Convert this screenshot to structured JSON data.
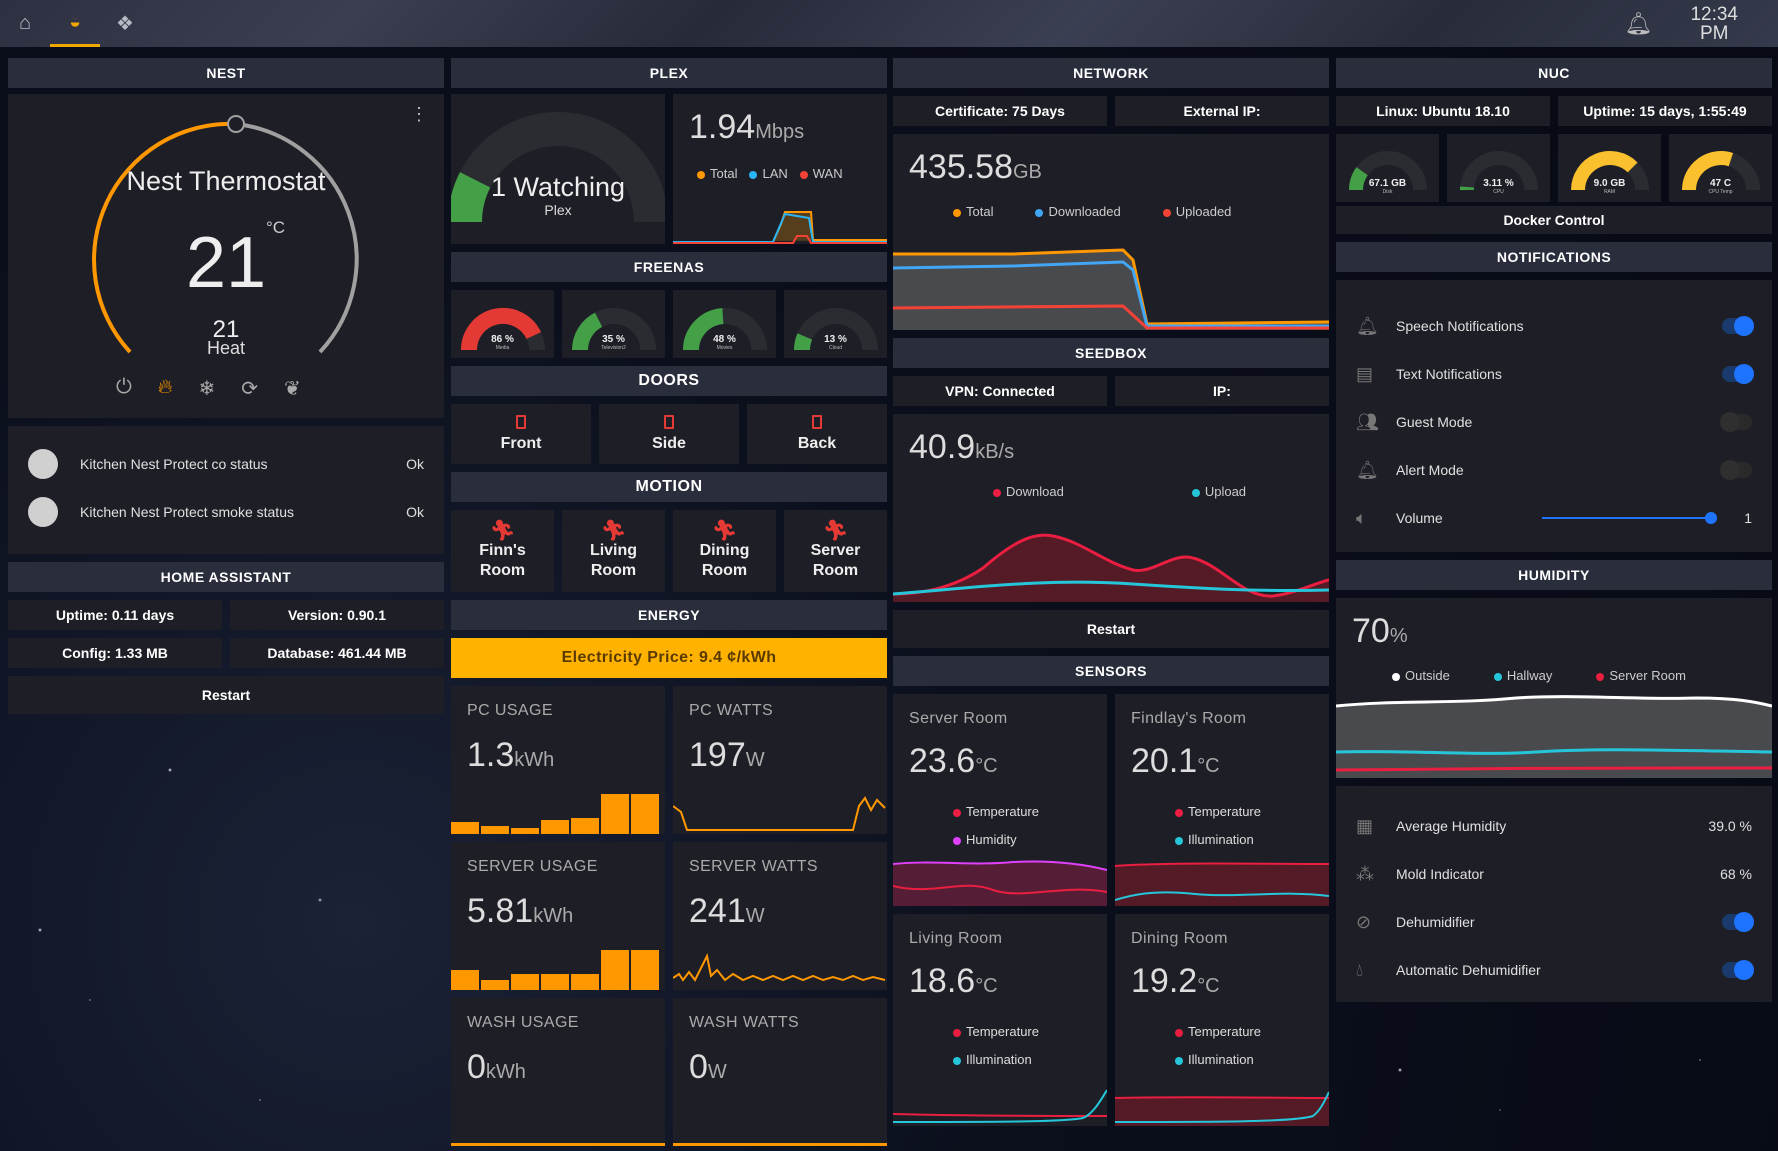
{
  "topbar": {
    "tabs": [
      "home-icon",
      "dashboard-icon",
      "plex-icon"
    ],
    "active_tab": 1,
    "clock_time": "12:34",
    "clock_ampm": "PM"
  },
  "nest": {
    "header": "NEST",
    "name": "Nest Thermostat",
    "target": "21",
    "unit": "°C",
    "current": "21",
    "mode": "Heat",
    "protect": [
      {
        "label": "Kitchen Nest Protect co status",
        "value": "Ok"
      },
      {
        "label": "Kitchen Nest Protect smoke status",
        "value": "Ok"
      }
    ]
  },
  "ha": {
    "header": "HOME ASSISTANT",
    "uptime": "Uptime: 0.11 days",
    "version": "Version: 0.90.1",
    "config": "Config: 1.33 MB",
    "database": "Database: 461.44 MB",
    "restart": "Restart"
  },
  "plex": {
    "header": "PLEX",
    "watching": "1 Watching",
    "watching_sub": "Plex",
    "watching_fraction": 0.15,
    "speed": "1.94",
    "speed_unit": "Mbps",
    "legend": [
      "Total",
      "LAN",
      "WAN"
    ]
  },
  "freenas": {
    "header": "FREENAS",
    "gauges": [
      {
        "value": "86 %",
        "label": "Media",
        "pct": 86,
        "color": "#e53935"
      },
      {
        "value": "35 %",
        "label": "Television2",
        "pct": 35,
        "color": "#43a047"
      },
      {
        "value": "48 %",
        "label": "Movies",
        "pct": 48,
        "color": "#43a047"
      },
      {
        "value": "13 %",
        "label": "Cloud",
        "pct": 13,
        "color": "#43a047"
      }
    ]
  },
  "doors": {
    "header": "DOORS",
    "items": [
      "Front",
      "Side",
      "Back"
    ]
  },
  "motion": {
    "header": "MOTION",
    "items": [
      [
        "Finn's",
        "Room"
      ],
      [
        "Living",
        "Room"
      ],
      [
        "Dining",
        "Room"
      ],
      [
        "Server",
        "Room"
      ]
    ]
  },
  "energy": {
    "header": "ENERGY",
    "price": "Electricity Price: 9.4 ¢/kWh",
    "tiles": [
      {
        "title": "PC USAGE",
        "value": "1.3",
        "unit": "kWh"
      },
      {
        "title": "PC WATTS",
        "value": "197",
        "unit": "W"
      },
      {
        "title": "SERVER USAGE",
        "value": "5.81",
        "unit": "kWh"
      },
      {
        "title": "SERVER WATTS",
        "value": "241",
        "unit": "W"
      },
      {
        "title": "WASH USAGE",
        "value": "0",
        "unit": "kWh"
      },
      {
        "title": "WASH WATTS",
        "value": "0",
        "unit": "W"
      }
    ]
  },
  "network": {
    "header": "NETWORK",
    "certificate": "Certificate: 75 Days",
    "external_ip": "External IP:",
    "total": "435.58",
    "unit": "GB",
    "legend": [
      "Total",
      "Downloaded",
      "Uploaded"
    ]
  },
  "seedbox": {
    "header": "SEEDBOX",
    "vpn": "VPN: Connected",
    "ip": "IP:",
    "speed": "40.9",
    "unit": "kB/s",
    "legend": [
      "Download",
      "Upload"
    ],
    "restart": "Restart"
  },
  "sensors": {
    "header": "SENSORS",
    "rooms": [
      {
        "name": "Server Room",
        "temp": "23.6",
        "unit": "°C",
        "l1": "Temperature",
        "l2": "Humidity",
        "c2": "#e040fb"
      },
      {
        "name": "Findlay's Room",
        "temp": "20.1",
        "unit": "°C",
        "l1": "Temperature",
        "l2": "Illumination",
        "c2": "#26c6da"
      },
      {
        "name": "Living Room",
        "temp": "18.6",
        "unit": "°C",
        "l1": "Temperature",
        "l2": "Illumination",
        "c2": "#26c6da"
      },
      {
        "name": "Dining Room",
        "temp": "19.2",
        "unit": "°C",
        "l1": "Temperature",
        "l2": "Illumination",
        "c2": "#26c6da"
      }
    ]
  },
  "nuc": {
    "header": "NUC",
    "os": "Linux: Ubuntu 18.10",
    "uptime": "Uptime: 15 days, 1:55:49",
    "docker": "Docker Control",
    "gauges": [
      {
        "value": "67.1 GB",
        "label": "Disk",
        "pct": 20,
        "color": "#43a047"
      },
      {
        "value": "3.11 %",
        "label": "CPU",
        "pct": 3,
        "color": "#43a047"
      },
      {
        "value": "9.0 GB",
        "label": "RAM",
        "pct": 75,
        "color": "#fbc02d"
      },
      {
        "value": "47 C",
        "label": "CPU Temp",
        "pct": 60,
        "color": "#fbc02d"
      }
    ]
  },
  "notifications": {
    "header": "NOTIFICATIONS",
    "items": [
      {
        "icon": "bell-outline-icon",
        "label": "Speech Notifications",
        "on": true
      },
      {
        "icon": "message-icon",
        "label": "Text Notifications",
        "on": true
      },
      {
        "icon": "group-icon",
        "label": "Guest Mode",
        "on": false
      },
      {
        "icon": "bell-icon",
        "label": "Alert Mode",
        "on": false
      }
    ],
    "volume_label": "Volume",
    "volume_value": "1",
    "volume_fraction": 1.0
  },
  "humidity": {
    "header": "HUMIDITY",
    "value": "70",
    "unit": "%",
    "legend": [
      "Outside",
      "Hallway",
      "Server Room"
    ],
    "rows": [
      {
        "label": "Average Humidity",
        "value": "39.0 %"
      },
      {
        "label": "Mold Indicator",
        "value": "68 %"
      }
    ],
    "toggles": [
      {
        "label": "Dehumidifier",
        "on": true
      },
      {
        "label": "Automatic Dehumidifier",
        "on": true
      }
    ]
  }
}
